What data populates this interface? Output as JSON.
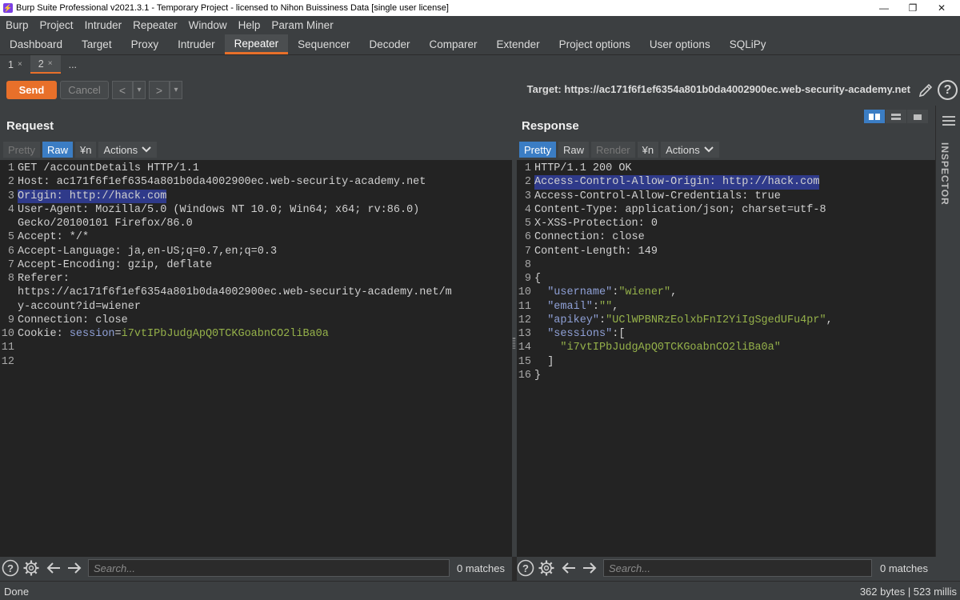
{
  "window": {
    "title": "Burp Suite Professional v2021.3.1 - Temporary Project - licensed to Nihon Buissiness Data [single user license]",
    "min_label": "—",
    "restore_label": "❐",
    "close_label": "✕"
  },
  "menu": [
    "Burp",
    "Project",
    "Intruder",
    "Repeater",
    "Window",
    "Help",
    "Param Miner"
  ],
  "tabs": [
    {
      "label": "Dashboard",
      "active": false
    },
    {
      "label": "Target",
      "active": false
    },
    {
      "label": "Proxy",
      "active": false
    },
    {
      "label": "Intruder",
      "active": false
    },
    {
      "label": "Repeater",
      "active": true
    },
    {
      "label": "Sequencer",
      "active": false
    },
    {
      "label": "Decoder",
      "active": false
    },
    {
      "label": "Comparer",
      "active": false
    },
    {
      "label": "Extender",
      "active": false
    },
    {
      "label": "Project options",
      "active": false
    },
    {
      "label": "User options",
      "active": false
    },
    {
      "label": "SQLiPy",
      "active": false
    }
  ],
  "repeater_tabs": [
    {
      "label": "1",
      "close": "×",
      "active": false
    },
    {
      "label": "2",
      "close": "×",
      "active": true
    },
    {
      "label": "...",
      "close": "",
      "active": false
    }
  ],
  "toolbar": {
    "send_label": "Send",
    "cancel_label": "Cancel",
    "back_label": "<",
    "forward_label": ">",
    "dropdown_label": "▾",
    "target_text": "Target: https://ac171f6f1ef6354a801b0da4002900ec.web-security-academy.net",
    "help_label": "?"
  },
  "request": {
    "title": "Request",
    "buttons": {
      "pretty": "Pretty",
      "raw": "Raw",
      "newline": "¥n",
      "actions": "Actions"
    },
    "lines": [
      {
        "n": "1",
        "parts": [
          {
            "t": "GET /accountDetails HTTP/1.1",
            "c": "code"
          }
        ]
      },
      {
        "n": "2",
        "parts": [
          {
            "t": "Host: ac171f6f1ef6354a801b0da4002900ec.web-security-academy.net",
            "c": "code"
          }
        ]
      },
      {
        "n": "3",
        "parts": [
          {
            "t": "Origin: http://hack.com",
            "c": "code hl"
          }
        ]
      },
      {
        "n": "4",
        "parts": [
          {
            "t": "User-Agent: Mozilla/5.0 (Windows NT 10.0; Win64; x64; rv:86.0)",
            "c": "code"
          }
        ]
      },
      {
        "n": "",
        "parts": [
          {
            "t": "Gecko/20100101 Firefox/86.0",
            "c": "code"
          }
        ]
      },
      {
        "n": "5",
        "parts": [
          {
            "t": "Accept: */*",
            "c": "code"
          }
        ]
      },
      {
        "n": "6",
        "parts": [
          {
            "t": "Accept-Language: ja,en-US;q=0.7,en;q=0.3",
            "c": "code"
          }
        ]
      },
      {
        "n": "7",
        "parts": [
          {
            "t": "Accept-Encoding: gzip, deflate",
            "c": "code"
          }
        ]
      },
      {
        "n": "8",
        "parts": [
          {
            "t": "Referer:",
            "c": "code"
          }
        ]
      },
      {
        "n": "",
        "parts": [
          {
            "t": "https://ac171f6f1ef6354a801b0da4002900ec.web-security-academy.net/m",
            "c": "code"
          }
        ]
      },
      {
        "n": "",
        "parts": [
          {
            "t": "y-account?id=wiener",
            "c": "code"
          }
        ]
      },
      {
        "n": "9",
        "parts": [
          {
            "t": "Connection: close",
            "c": "code"
          }
        ]
      },
      {
        "n": "10",
        "parts": [
          {
            "t": "Cookie: ",
            "c": "code"
          },
          {
            "t": "session",
            "c": "k"
          },
          {
            "t": "=",
            "c": "code"
          },
          {
            "t": "i7vtIPbJudgApQ0TCKGoabnCO2liBa0a",
            "c": "v"
          }
        ]
      },
      {
        "n": "11",
        "parts": [
          {
            "t": "",
            "c": "code"
          }
        ]
      },
      {
        "n": "12",
        "parts": [
          {
            "t": "",
            "c": "code"
          }
        ]
      }
    ]
  },
  "response": {
    "title": "Response",
    "buttons": {
      "pretty": "Pretty",
      "raw": "Raw",
      "render": "Render",
      "newline": "¥n",
      "actions": "Actions"
    },
    "lines": [
      {
        "n": "1",
        "parts": [
          {
            "t": "HTTP/1.1 200 OK",
            "c": "code"
          }
        ]
      },
      {
        "n": "2",
        "parts": [
          {
            "t": "Access-Control-Allow-Origin: http://hack.com",
            "c": "code hl"
          }
        ]
      },
      {
        "n": "3",
        "parts": [
          {
            "t": "Access-Control-Allow-Credentials: true",
            "c": "code"
          }
        ]
      },
      {
        "n": "4",
        "parts": [
          {
            "t": "Content-Type: application/json; charset=utf-8",
            "c": "code"
          }
        ]
      },
      {
        "n": "5",
        "parts": [
          {
            "t": "X-XSS-Protection: 0",
            "c": "code"
          }
        ]
      },
      {
        "n": "6",
        "parts": [
          {
            "t": "Connection: close",
            "c": "code"
          }
        ]
      },
      {
        "n": "7",
        "parts": [
          {
            "t": "Content-Length: 149",
            "c": "code"
          }
        ]
      },
      {
        "n": "8",
        "parts": [
          {
            "t": "",
            "c": "code"
          }
        ]
      },
      {
        "n": "9",
        "parts": [
          {
            "t": "{",
            "c": "code"
          }
        ]
      },
      {
        "n": "10",
        "parts": [
          {
            "t": "  ",
            "c": "code"
          },
          {
            "t": "\"username\"",
            "c": "k"
          },
          {
            "t": ":",
            "c": "code"
          },
          {
            "t": "\"wiener\"",
            "c": "v"
          },
          {
            "t": ",",
            "c": "code"
          }
        ]
      },
      {
        "n": "11",
        "parts": [
          {
            "t": "  ",
            "c": "code"
          },
          {
            "t": "\"email\"",
            "c": "k"
          },
          {
            "t": ":",
            "c": "code"
          },
          {
            "t": "\"\"",
            "c": "v"
          },
          {
            "t": ",",
            "c": "code"
          }
        ]
      },
      {
        "n": "12",
        "parts": [
          {
            "t": "  ",
            "c": "code"
          },
          {
            "t": "\"apikey\"",
            "c": "k"
          },
          {
            "t": ":",
            "c": "code"
          },
          {
            "t": "\"UClWPBNRzEolxbFnI2YiIgSgedUFu4pr\"",
            "c": "v"
          },
          {
            "t": ",",
            "c": "code"
          }
        ]
      },
      {
        "n": "13",
        "parts": [
          {
            "t": "  ",
            "c": "code"
          },
          {
            "t": "\"sessions\"",
            "c": "k"
          },
          {
            "t": ":[",
            "c": "code"
          }
        ]
      },
      {
        "n": "14",
        "parts": [
          {
            "t": "    ",
            "c": "code"
          },
          {
            "t": "\"i7vtIPbJudgApQ0TCKGoabnCO2liBa0a\"",
            "c": "v"
          }
        ]
      },
      {
        "n": "15",
        "parts": [
          {
            "t": "  ]",
            "c": "code"
          }
        ]
      },
      {
        "n": "16",
        "parts": [
          {
            "t": "}",
            "c": "code"
          }
        ]
      }
    ]
  },
  "inspector_label": "INSPECTOR",
  "search": {
    "placeholder": "Search...",
    "request_matches": "0 matches",
    "response_matches": "0 matches"
  },
  "status": {
    "left": "Done",
    "right": "362 bytes | 523 millis"
  },
  "colors": {
    "accent": "#e8702a",
    "selected": "#3b7dc4",
    "highlight": "#2f3a8a",
    "json_key": "#8fa0d6",
    "json_value": "#95b14a"
  }
}
